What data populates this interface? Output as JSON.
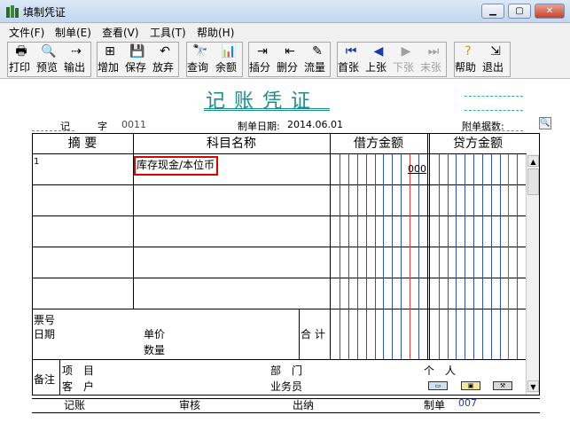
{
  "window": {
    "title": "填制凭证"
  },
  "menu": [
    "文件(F)",
    "制单(E)",
    "查看(V)",
    "工具(T)",
    "帮助(H)"
  ],
  "toolbar": {
    "print": "打印",
    "preview": "预览",
    "export": "输出",
    "add": "增加",
    "save": "保存",
    "abandon": "放弃",
    "query": "查询",
    "balance": "余额",
    "insert": "插分",
    "delete": "删分",
    "flow": "流量",
    "first": "首张",
    "prev": "上张",
    "next": "下张",
    "last": "末张",
    "help": "帮助",
    "exit": "退出"
  },
  "voucher": {
    "title": "记账凭证",
    "type_label": "记",
    "number_label": "字",
    "number": "0011",
    "date_label": "制单日期:",
    "date": "2014.06.01",
    "attach_label": "附单据数:"
  },
  "columns": {
    "summary": "摘 要",
    "account": "科目名称",
    "debit": "借方金额",
    "credit": "贷方金额"
  },
  "rows": [
    {
      "no": "1",
      "summary": "",
      "account": "库存现金/本位币",
      "debit": "000",
      "credit": ""
    }
  ],
  "bottom": {
    "ticket_no": "票号",
    "date": "日期",
    "unit_price": "单价",
    "quantity": "数量",
    "total": "合 计",
    "remark": "备注",
    "project": "项　目",
    "customer": "客　户",
    "department": "部　门",
    "salesman": "业务员",
    "person": "个　人"
  },
  "footer": {
    "bookkeep": "记账",
    "review": "审核",
    "cashier": "出纳",
    "maker_label": "制单",
    "maker": "007"
  },
  "colors": {
    "title": "#1b8c8c",
    "highlight": "#e00000",
    "maker": "#1c3fa8"
  }
}
